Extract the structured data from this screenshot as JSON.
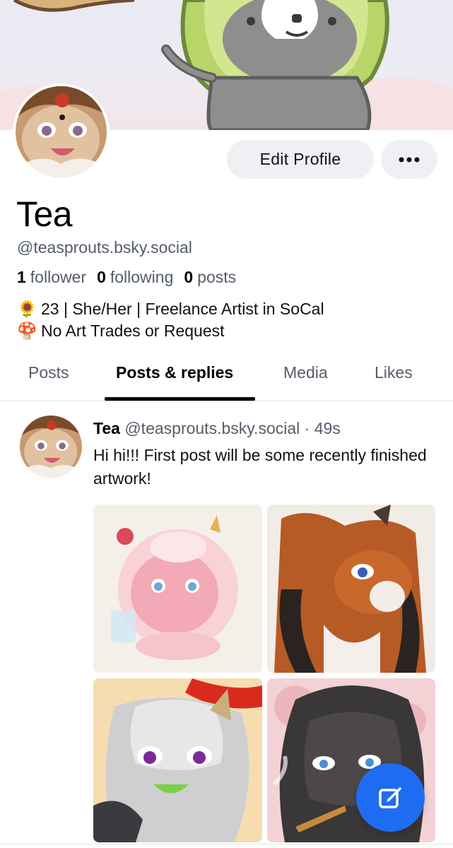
{
  "profile": {
    "display_name": "Tea",
    "handle": "@teasprouts.bsky.social",
    "followers_count": "1",
    "followers_label": "follower",
    "following_count": "0",
    "following_label": "following",
    "posts_count": "0",
    "posts_label": "posts",
    "bio": [
      {
        "emoji": "🌻",
        "text": "23 | She/Her | Freelance Artist in SoCal"
      },
      {
        "emoji": "🍄",
        "text": "No Art Trades or Request"
      }
    ]
  },
  "actions": {
    "edit_profile_label": "Edit Profile",
    "more_icon": "ellipsis-icon"
  },
  "tabs": [
    {
      "label": "Posts",
      "active": false
    },
    {
      "label": "Posts & replies",
      "active": true
    },
    {
      "label": "Media",
      "active": false
    },
    {
      "label": "Likes",
      "active": false
    }
  ],
  "post": {
    "author_name": "Tea",
    "author_handle": "@teasprouts.bsky.social",
    "separator": "·",
    "time": "49s",
    "text": "Hi hi!!! First post will be some recently finished artwork!"
  },
  "fab": {
    "icon": "compose-icon"
  },
  "colors": {
    "accent": "#1e6cf2",
    "button_bg": "#eef0f4",
    "muted_text": "#555d69"
  }
}
